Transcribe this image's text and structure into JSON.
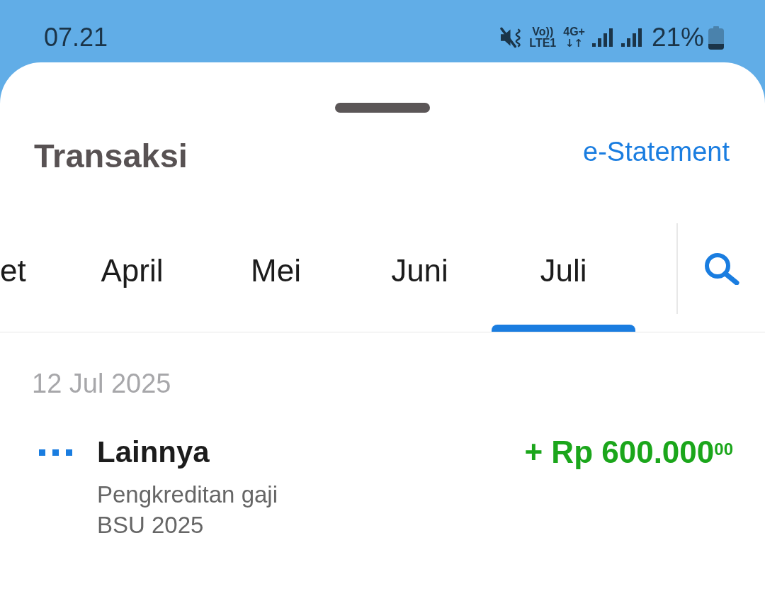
{
  "status_bar": {
    "time": "07.21",
    "volte": "Vo))",
    "lte": "LTE1",
    "network": "4G+",
    "data_arrows": "↓↑",
    "battery": "21%"
  },
  "header": {
    "title": "Transaksi",
    "link": "e-Statement"
  },
  "month_tabs": [
    {
      "label": "et",
      "selected": false
    },
    {
      "label": "April",
      "selected": false
    },
    {
      "label": "Mei",
      "selected": false
    },
    {
      "label": "Juni",
      "selected": false
    },
    {
      "label": "Juli",
      "selected": true
    }
  ],
  "transaction_groups": [
    {
      "date": "12 Jul 2025",
      "transactions": [
        {
          "category": "Lainnya",
          "description": "Pengkreditan gaji BSU 2025",
          "amount": "+ Rp 600.000$^{00}$",
          "kind": "credit"
        }
      ]
    }
  ]
}
